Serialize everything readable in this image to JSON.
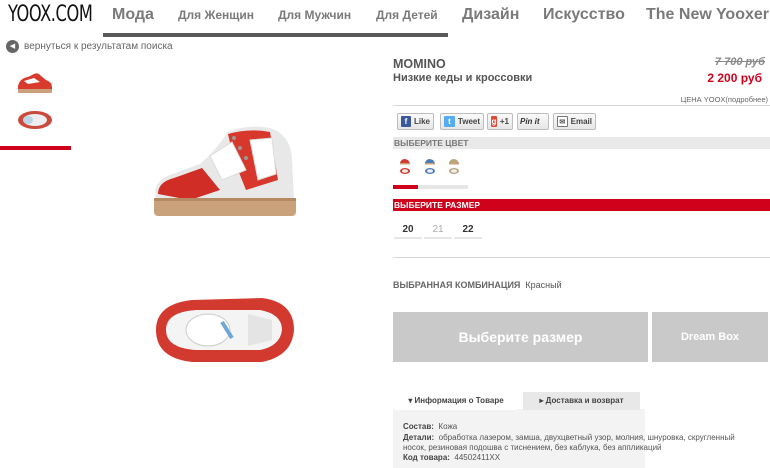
{
  "header": {
    "logo": "YOOX.COM",
    "nav": [
      {
        "label": "Мода"
      },
      {
        "label": "Для Женщин"
      },
      {
        "label": "Для Мужчин"
      },
      {
        "label": "Для Детей"
      },
      {
        "label": "Дизайн"
      },
      {
        "label": "Искусство"
      },
      {
        "label": "The New Yooxer"
      }
    ],
    "accent_color": "#d0021b"
  },
  "back_link": {
    "icon": "arrow-left-icon",
    "label": "вернуться к результатам поиска"
  },
  "product": {
    "brand": "MOMINO",
    "type": "Низкие кеды и кроссовки",
    "old_price": "7 700 руб",
    "new_price": "2 200 руб",
    "yoox_price_note": "ЦЕНА YOOX(подробнее)"
  },
  "social": {
    "like": "Like",
    "tweet": "Tweet",
    "plusone": "+1",
    "pinit": "Pin it",
    "email": "Email"
  },
  "color_section": {
    "title": "ВЫБЕРИТЕ ЦВЕТ"
  },
  "size_section": {
    "title": "ВЫБЕРИТЕ РАЗМЕР",
    "sizes": [
      {
        "label": "20",
        "available": true
      },
      {
        "label": "21",
        "available": false
      },
      {
        "label": "22",
        "available": true
      }
    ]
  },
  "combination": {
    "label": "ВЫБРАННАЯ КОМБИНАЦИЯ",
    "value": "Красный"
  },
  "buttons": {
    "select_size": "Выберите размер",
    "dream_box": "Dream Box"
  },
  "tabs": [
    {
      "label": "▾ Информация о Товаре"
    },
    {
      "label": "▸ Доставка и возврат"
    }
  ],
  "details": {
    "composition_label": "Состав:",
    "composition_value": "Кожа",
    "details_label": "Детали:",
    "details_value_1": "обработка лазером, замша, двухцветный узор, молния, шнуровка, скругленный",
    "details_value_2": "носок, резиновая подошва с тиснением, без каблука, без аппликаций",
    "code_label": "Код товара:",
    "code_value": "44502411XX"
  }
}
